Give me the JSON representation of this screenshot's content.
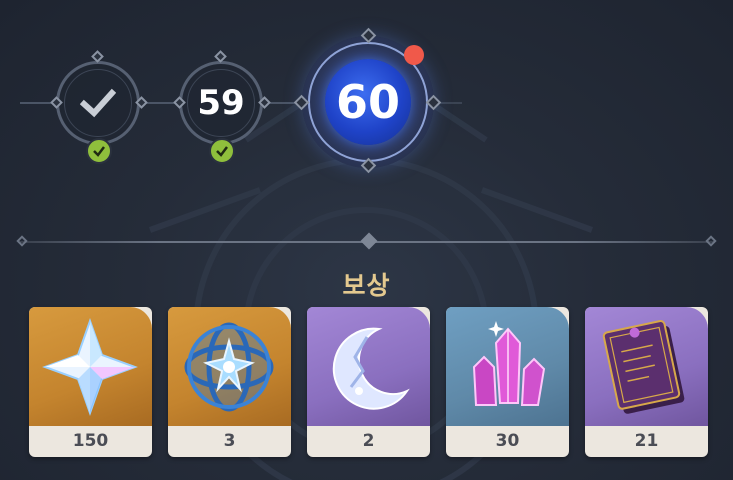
{
  "levels": [
    {
      "label": "",
      "state": "claimed",
      "icon": "checkmark-icon"
    },
    {
      "label": "59",
      "state": "claimed"
    },
    {
      "label": "60",
      "state": "current",
      "has_notification": true
    }
  ],
  "rewards_section": {
    "title": "보상",
    "items": [
      {
        "name": "primogem-icon",
        "count": "150",
        "rarity_color": "#c4842e"
      },
      {
        "name": "fate-orb-icon",
        "count": "3",
        "rarity_color": "#c4842e"
      },
      {
        "name": "moon-ore-icon",
        "count": "2",
        "rarity_color": "#8a6fbf"
      },
      {
        "name": "purple-crystal-icon",
        "count": "30",
        "rarity_color": "#5f89a8"
      },
      {
        "name": "exp-book-icon",
        "count": "21",
        "rarity_color": "#8a6fbf"
      }
    ]
  },
  "colors": {
    "check_badge": "#8fbf3c",
    "current_core": "#2a55e0",
    "notification_dot": "#f0594a",
    "title_gold": "#e4c98f"
  }
}
